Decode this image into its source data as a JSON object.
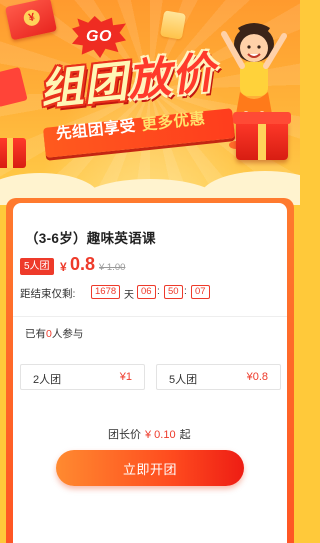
{
  "banner": {
    "go_text": "GO",
    "title_part1": "组团",
    "title_part2": "放价",
    "subtitle_part1": "先组团享受",
    "subtitle_part2": "更多优惠"
  },
  "course": {
    "title": "（3-6岁）趣味英语课",
    "group_badge": "5人团",
    "currency": "¥",
    "price": "0.8",
    "original_price": "¥ 1.00"
  },
  "countdown": {
    "label": "距结束仅剩:",
    "days": "1678",
    "day_unit": "天",
    "hours": "06",
    "minutes": "50",
    "seconds": "07",
    "separator": ":"
  },
  "participation": {
    "prefix": "已有",
    "count": "0",
    "suffix": "人参与"
  },
  "tiers": [
    {
      "label": "2人团",
      "price": "¥1"
    },
    {
      "label": "5人团",
      "price": "¥0.8"
    }
  ],
  "leader": {
    "label": "团长价",
    "price": "¥ 0.10",
    "suffix": "起"
  },
  "cta_label": "立即开团",
  "colors": {
    "accent_red": "#ee3a2a",
    "banner_orange": "#ff9a2e",
    "page_yellow": "#ffc93a"
  }
}
